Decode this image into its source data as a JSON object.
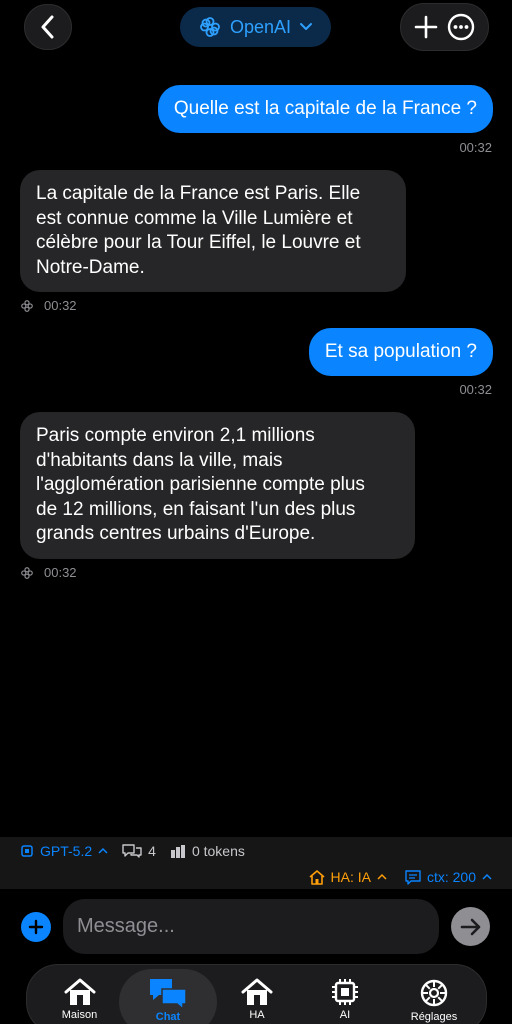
{
  "header": {
    "provider": "OpenAI"
  },
  "messages": [
    {
      "role": "user",
      "text": "Quelle est la capitale de la France ?",
      "time": "00:32"
    },
    {
      "role": "assistant",
      "lines": [
        "La capitale de la France est Paris. Elle",
        "est connue comme la Ville Lumière et",
        "célèbre pour la Tour Eiffel, le Louvre et",
        "Notre-Dame."
      ],
      "time": "00:32"
    },
    {
      "role": "user",
      "text": "Et sa population ?",
      "time": "00:32"
    },
    {
      "role": "assistant",
      "lines": [
        "Paris compte environ 2,1 millions",
        "d'habitants dans la ville, mais",
        "l'agglomération parisienne compte plus",
        "de 12 millions, en faisant l'un des plus",
        "grands centres urbains d'Europe."
      ],
      "time": "00:32"
    }
  ],
  "status": {
    "model": "GPT-5.2",
    "message_count": "4",
    "tokens": "0 tokens",
    "ha_mode": "HA: IA",
    "context": "ctx: 200"
  },
  "composer": {
    "placeholder": "Message..."
  },
  "tabs": [
    {
      "label": "Maison",
      "icon": "house-icon"
    },
    {
      "label": "Chat",
      "icon": "chat-bubbles-icon"
    },
    {
      "label": "HA",
      "icon": "home-assistant-icon"
    },
    {
      "label": "AI",
      "icon": "chip-icon"
    },
    {
      "label": "Réglages",
      "icon": "gear-icon"
    }
  ],
  "active_tab": "Chat",
  "colors": {
    "accent": "#0a84ff",
    "user_bubble": "#0a84ff",
    "ai_bubble": "#262628",
    "warning": "#ff9f0a",
    "background": "#000000"
  }
}
